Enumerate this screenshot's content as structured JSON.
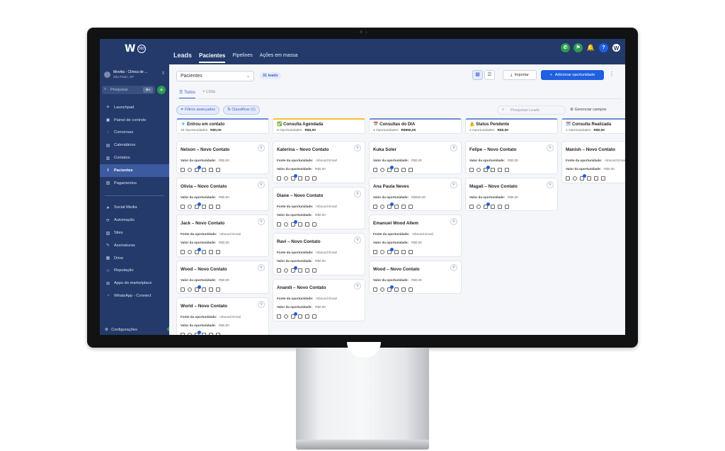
{
  "app": {
    "logo": "W",
    "logo_badge": "360",
    "nav": [
      "Leads",
      "Pacientes",
      "Pipelines",
      "Ações em massa"
    ],
    "active_nav": "Pacientes",
    "topbar_user": "W",
    "topbar_help": "?",
    "colors": {
      "navy": "#233a6b",
      "accent": "#1f5fe0",
      "green": "#2e9b4e"
    }
  },
  "sidebar": {
    "account_name": "Movitta - Clínica de ...",
    "account_location": "São Paulo, SP",
    "search_placeholder": "Pesquisar",
    "search_kbd": "⌘K",
    "items_top": [
      {
        "label": "Launchpad",
        "icon": "rocket-icon"
      },
      {
        "label": "Painel de controle",
        "icon": "dashboard-icon"
      },
      {
        "label": "Conversas",
        "icon": "chat-icon"
      },
      {
        "label": "Calendários",
        "icon": "calendar-icon"
      },
      {
        "label": "Contatos",
        "icon": "contacts-icon"
      },
      {
        "label": "Pacientes",
        "icon": "patients-icon",
        "active": true
      },
      {
        "label": "Pagamentos",
        "icon": "payments-icon"
      }
    ],
    "items_bottom": [
      {
        "label": "Social Media",
        "icon": "send-icon"
      },
      {
        "label": "Automação",
        "icon": "automation-icon"
      },
      {
        "label": "Sites",
        "icon": "sites-icon"
      },
      {
        "label": "Assinaturas",
        "icon": "signature-icon"
      },
      {
        "label": "Drive",
        "icon": "drive-icon"
      },
      {
        "label": "Reputação",
        "icon": "reputation-icon"
      },
      {
        "label": "Apps do marketplace",
        "icon": "marketplace-icon"
      },
      {
        "label": "WhatsApp - Connect",
        "icon": "whatsapp-icon"
      }
    ],
    "settings_label": "Configurações"
  },
  "toolbar": {
    "pipeline_select": "Pacientes",
    "lead_count": "31 leads",
    "import_label": "Importar",
    "add_label": "Adicionar oportunidade",
    "tab_all": "Todos",
    "tab_list": "Lista",
    "filter_label": "Filtros avançados",
    "sort_label": "Classificar (1)",
    "search_placeholder": "Pesquisar Leads",
    "manage_label": "Gerenciar campos"
  },
  "labels": {
    "source": "Fonte da oportunidade:",
    "value": "Valor da oportunidade:"
  },
  "columns": [
    {
      "title": "Entrou em contato",
      "emoji": "📧",
      "color": "#6b8dd6",
      "opps": "15 Oportunidades",
      "total": "R$0,00",
      "cards": [
        {
          "name": "Nelson – Novo Contato",
          "value": "R$0,00"
        },
        {
          "name": "Olivia – Novo Contato",
          "value": "R$0,00"
        },
        {
          "name": "Jack – Novo Contato",
          "source": "Inbound Email",
          "value": "R$0,00"
        },
        {
          "name": "Wood – Novo Contato",
          "value": "R$0,00"
        },
        {
          "name": "World – Novo Contato",
          "source": "Inbound Email",
          "value": "R$0,00"
        }
      ]
    },
    {
      "title": "Consulta Agendada",
      "emoji": "✅",
      "color": "#f2c230",
      "opps": "8 Oportunidades",
      "total": "R$0,00",
      "cards": [
        {
          "name": "Katerina – Novo Contato",
          "source": "Inbound Email",
          "value": "R$0,00"
        },
        {
          "name": "Diane – Novo Contato",
          "source": "Inbound Email",
          "value": "R$0,00"
        },
        {
          "name": "Ravi – Novo Contato",
          "source": "Inbound Email",
          "value": "R$0,00"
        },
        {
          "name": "Anandi – Novo Contato",
          "source": "Inbound Email",
          "value": "R$0,00"
        }
      ]
    },
    {
      "title": "Consultas do DIA",
      "emoji": "📅",
      "color": "#6b8dd6",
      "opps": "4 Oportunidades",
      "total": "R$650,00",
      "cards": [
        {
          "name": "Kuka Soler",
          "value": "R$0,00"
        },
        {
          "name": "Ana Paula Neves",
          "value": "R$650,00"
        },
        {
          "name": "Emanuel Wood Allem",
          "source": "Inbound Email",
          "value": "R$0,00"
        },
        {
          "name": "Wood – Novo Contato",
          "value": "R$0,00"
        }
      ]
    },
    {
      "title": "Status Pendente",
      "emoji": "⚠️",
      "color": "#6b8dd6",
      "opps": "2 Oportunidades",
      "total": "R$0,00",
      "cards": [
        {
          "name": "Felipe – Novo Contato",
          "value": "R$0,00"
        },
        {
          "name": "Magali – Novo Contato",
          "value": "R$0,00"
        }
      ]
    },
    {
      "title": "Consulta Realizada",
      "emoji": "🗓️",
      "color": "#6b8dd6",
      "opps": "1 Oportunidades",
      "total": "R$0,00",
      "cards": [
        {
          "name": "Manish – Novo Contato",
          "source": "Inbound Email",
          "value": "R$0,00"
        }
      ]
    }
  ]
}
